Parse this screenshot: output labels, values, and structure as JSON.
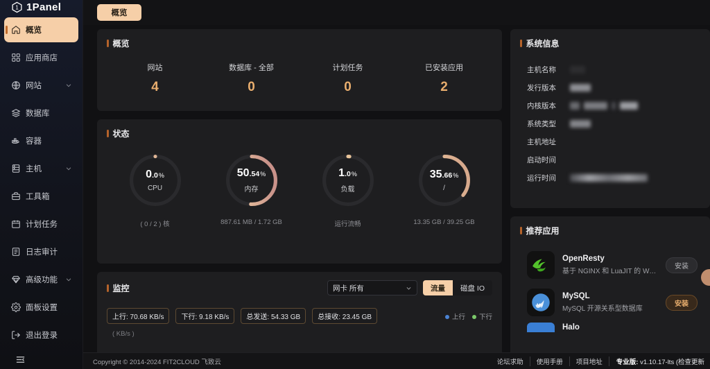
{
  "brand": {
    "name": "1Panel",
    "logo_icon": "hexagon-one-icon"
  },
  "sidebar": {
    "items": [
      {
        "label": "概览",
        "icon": "home-icon",
        "active": true,
        "expandable": false
      },
      {
        "label": "应用商店",
        "icon": "apps-grid-icon",
        "active": false,
        "expandable": false
      },
      {
        "label": "网站",
        "icon": "globe-icon",
        "active": false,
        "expandable": true
      },
      {
        "label": "数据库",
        "icon": "database-icon",
        "active": false,
        "expandable": false
      },
      {
        "label": "容器",
        "icon": "container-docker-icon",
        "active": false,
        "expandable": false
      },
      {
        "label": "主机",
        "icon": "server-icon",
        "active": false,
        "expandable": true
      },
      {
        "label": "工具箱",
        "icon": "toolbox-icon",
        "active": false,
        "expandable": false
      },
      {
        "label": "计划任务",
        "icon": "calendar-icon",
        "active": false,
        "expandable": false
      },
      {
        "label": "日志审计",
        "icon": "list-document-icon",
        "active": false,
        "expandable": false
      },
      {
        "label": "高级功能",
        "icon": "diamond-icon",
        "active": false,
        "expandable": true
      },
      {
        "label": "面板设置",
        "icon": "gear-icon",
        "active": false,
        "expandable": false
      },
      {
        "label": "退出登录",
        "icon": "logout-icon",
        "active": false,
        "expandable": false
      }
    ],
    "collapse_icon": "collapse-menu-icon"
  },
  "tabs": [
    {
      "label": "概览",
      "active": true
    }
  ],
  "overview": {
    "title": "概览",
    "stats": [
      {
        "label": "网站",
        "value": "4"
      },
      {
        "label": "数据库 - 全部",
        "value": "0"
      },
      {
        "label": "计划任务",
        "value": "0"
      },
      {
        "label": "已安装应用",
        "value": "2"
      }
    ]
  },
  "status": {
    "title": "状态",
    "gauges": [
      {
        "name": "CPU",
        "int": "0",
        "dec": ".0",
        "sym": "%",
        "percent": 0,
        "sub": "( 0 / 2 ) 核"
      },
      {
        "name": "内存",
        "int": "50",
        "dec": ".54",
        "sym": "%",
        "percent": 50.54,
        "sub": "887.61 MB / 1.72 GB"
      },
      {
        "name": "负载",
        "int": "1",
        "dec": ".0",
        "sym": "%",
        "percent": 1,
        "sub": "运行流畅"
      },
      {
        "name": "/",
        "int": "35",
        "dec": ".66",
        "sym": "%",
        "percent": 35.66,
        "sub": "13.35 GB / 39.25 GB"
      }
    ]
  },
  "monitor": {
    "title": "监控",
    "select_value": "网卡 所有",
    "segments": [
      {
        "label": "流量",
        "active": true
      },
      {
        "label": "磁盘 IO",
        "active": false
      }
    ],
    "chips": [
      "上行: 70.68 KB/s",
      "下行: 9.18 KB/s",
      "总发送: 54.33 GB",
      "总接收: 23.45 GB"
    ],
    "legend": [
      {
        "label": "上行",
        "color": "#4b83d4"
      },
      {
        "label": "下行",
        "color": "#7bc96a"
      }
    ],
    "unit": "( KB/s )"
  },
  "system_info": {
    "title": "系统信息",
    "rows": [
      {
        "key": "主机名称",
        "redacted": []
      },
      {
        "key": "发行版本",
        "redacted": [
          46
        ]
      },
      {
        "key": "内核版本",
        "redacted": [
          22,
          90,
          8,
          52
        ]
      },
      {
        "key": "系统类型",
        "redacted": [
          46
        ]
      },
      {
        "key": "主机地址",
        "redacted": []
      },
      {
        "key": "启动时间",
        "redacted": []
      },
      {
        "key": "运行时间",
        "redacted": [
          120
        ]
      }
    ]
  },
  "recommend": {
    "title": "推荐应用",
    "apps": [
      {
        "name": "OpenResty",
        "desc": "基于 NGINX 和 LuaJIT 的 Web 平台",
        "button": "安装",
        "hot": false,
        "icon": "openresty-logo-icon"
      },
      {
        "name": "MySQL",
        "desc": "MySQL 开源关系型数据库",
        "button": "安装",
        "hot": true,
        "icon": "mysql-dolphin-icon"
      },
      {
        "name": "Halo",
        "desc": "",
        "button": "",
        "hot": false,
        "icon": "halo-logo-icon"
      }
    ]
  },
  "footer": {
    "copyright": "Copyright © 2014-2024 FIT2CLOUD 飞致云",
    "links": [
      "论坛求助",
      "使用手册",
      "项目地址"
    ],
    "edition_label": "专业版:",
    "version": "v1.10.17-lts (检查更新"
  },
  "colors": {
    "accent": "#f6cfa8",
    "accent_text": "#e9ae6e",
    "gauge_start": "#f0cfa0",
    "gauge_end": "#cf9b8a",
    "card_bg": "#1e1e20",
    "page_bg": "#111113"
  }
}
